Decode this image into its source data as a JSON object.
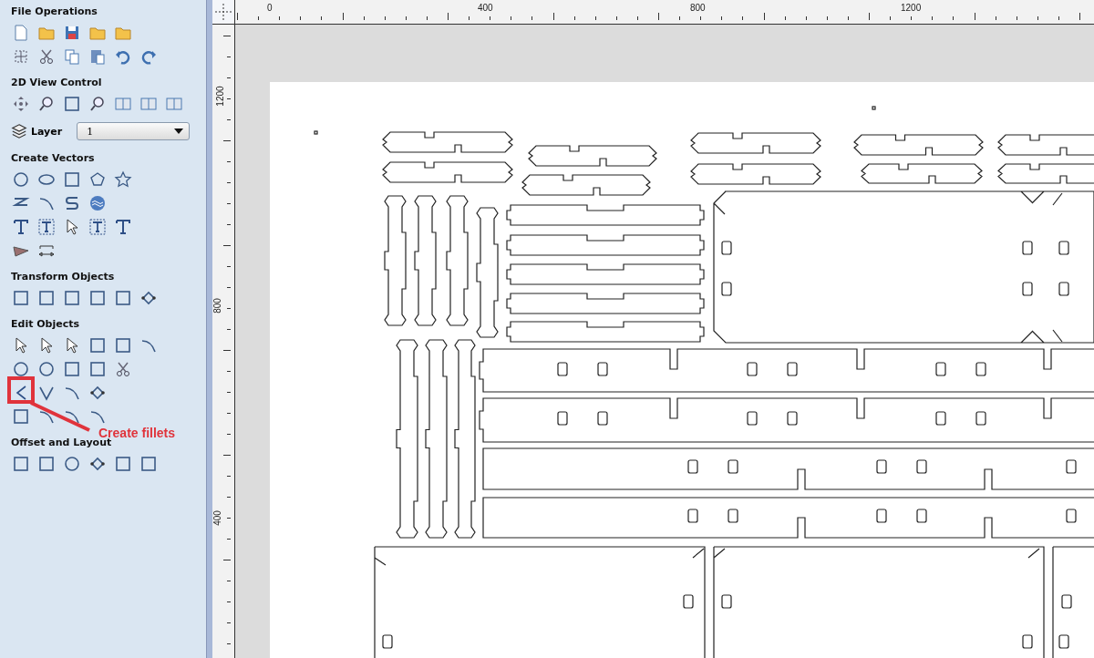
{
  "sidebar": {
    "sections": [
      {
        "title": "File Operations"
      },
      {
        "title": "2D View Control",
        "layer": {
          "label": "Layer",
          "value": "1"
        }
      },
      {
        "title": "Create Vectors"
      },
      {
        "title": "Transform Objects"
      },
      {
        "title": "Edit Objects"
      },
      {
        "title": "Offset and Layout"
      }
    ]
  },
  "annotation": {
    "text": "Create fillets"
  },
  "rulers": {
    "top_labels": [
      "0",
      "400",
      "800",
      "1200"
    ],
    "left_labels": [
      "1200",
      "800",
      "400"
    ]
  }
}
